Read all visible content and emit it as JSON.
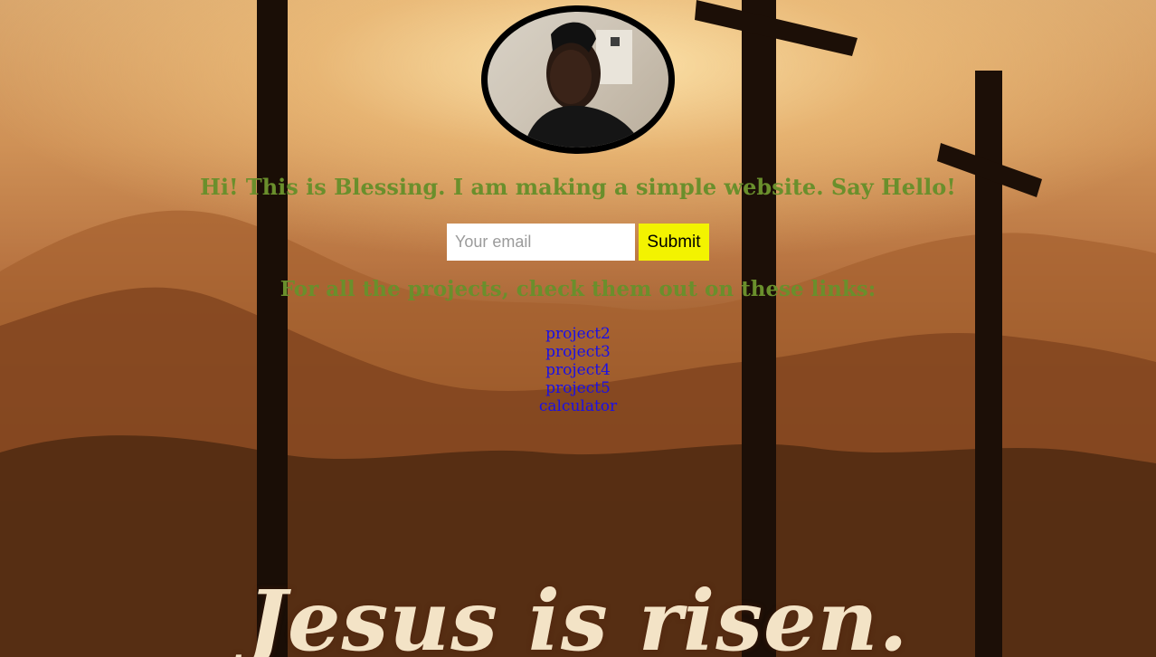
{
  "background": {
    "banner_text": "Jesus is risen.",
    "accent_color": "#6a8f2c",
    "link_color": "#1a10e6"
  },
  "profile": {
    "avatar_icon": "profile-photo"
  },
  "greeting": {
    "text": "Hi! This is Blessing. I am making a simple website. Say Hello!"
  },
  "signup": {
    "email_placeholder": "Your email",
    "email_value": "",
    "submit_label": "Submit",
    "submit_color": "#f3f300"
  },
  "projects": {
    "intro": "For all the projects, check them out on these links:",
    "links": [
      {
        "label": "project2"
      },
      {
        "label": "project3"
      },
      {
        "label": "project4"
      },
      {
        "label": "project5"
      },
      {
        "label": "calculator"
      }
    ]
  }
}
